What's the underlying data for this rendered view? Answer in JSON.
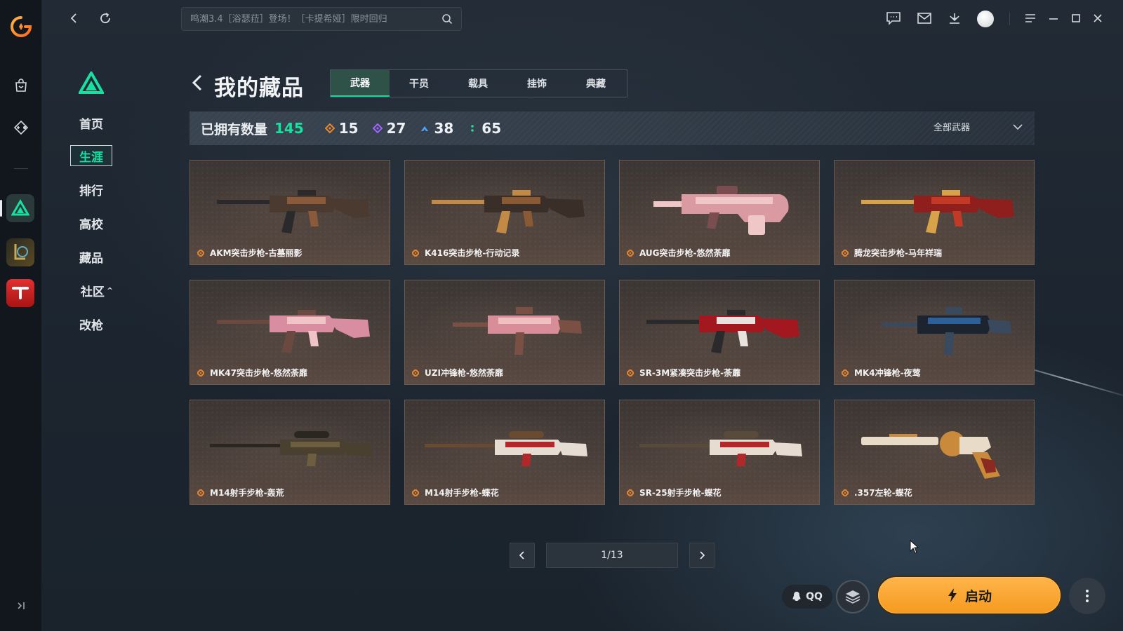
{
  "topbar": {
    "search_placeholder": "鸣潮3.4［浴瑟菈］登场！［卡提希娅］限时回归"
  },
  "sidenav": {
    "items": [
      {
        "label": "首页"
      },
      {
        "label": "生涯",
        "active": true
      },
      {
        "label": "排行"
      },
      {
        "label": "高校"
      },
      {
        "label": "藏品"
      },
      {
        "label": "社区",
        "has_submenu": true
      },
      {
        "label": "改枪"
      }
    ]
  },
  "header": {
    "title": "我的藏品",
    "tabs": [
      {
        "label": "武器",
        "active": true
      },
      {
        "label": "干员"
      },
      {
        "label": "载具"
      },
      {
        "label": "挂饰"
      },
      {
        "label": "典藏"
      }
    ]
  },
  "stats": {
    "owned_label": "已拥有数量",
    "owned_total": "145",
    "rarity_counts": [
      {
        "icon": "orange-diamond-icon",
        "color": "#e8872e",
        "count": "15"
      },
      {
        "icon": "purple-diamond-icon",
        "color": "#a064ff",
        "count": "27"
      },
      {
        "icon": "blue-chevron-icon",
        "color": "#4aa7ff",
        "count": "38"
      },
      {
        "icon": "green-dots-icon",
        "color": "#2fd69c",
        "count": "65"
      }
    ],
    "filter_label": "全部武器"
  },
  "items": [
    {
      "name": "AKM突击步枪-古墓丽影",
      "palette": [
        "#4a3a30",
        "#8a5a3a",
        "#2a2a2c"
      ]
    },
    {
      "name": "K416突击步枪-行动记录",
      "palette": [
        "#3a2e28",
        "#8a5a35",
        "#c28a45"
      ]
    },
    {
      "name": "AUG突击步枪-悠然荼靡",
      "palette": [
        "#d99aa2",
        "#f0c7c7",
        "#7a4d50"
      ]
    },
    {
      "name": "腾龙突击步枪-马年祥瑞",
      "palette": [
        "#8e1f1c",
        "#c23a26",
        "#d8a348"
      ]
    },
    {
      "name": "MK47突击步枪-悠然荼靡",
      "palette": [
        "#d88ea0",
        "#f0c3c7",
        "#6a4a40"
      ]
    },
    {
      "name": "UZI冲锋枪-悠然荼靡",
      "palette": [
        "#d88e98",
        "#f0c0c0",
        "#7a5045"
      ]
    },
    {
      "name": "SR-3M紧凑突击步枪-荼蘼",
      "palette": [
        "#a3181f",
        "#e8e2de",
        "#2a2a2c"
      ]
    },
    {
      "name": "MK4冲锋枪-夜莺",
      "palette": [
        "#1c2430",
        "#2d5f9a",
        "#3a4a5e"
      ]
    },
    {
      "name": "M14射手步枪-轰荒",
      "palette": [
        "#4a4030",
        "#6e5e40",
        "#2a2620"
      ]
    },
    {
      "name": "M14射手步枪-蝶花",
      "palette": [
        "#e6dcd2",
        "#b0282a",
        "#6a4a30"
      ]
    },
    {
      "name": "SR-25射手步枪-蝶花",
      "palette": [
        "#e6dcd2",
        "#b0282a",
        "#5a4a3a"
      ]
    },
    {
      "name": ".357左轮-蝶花",
      "palette": [
        "#e8dcc8",
        "#c98b3b",
        "#8a2a20"
      ]
    }
  ],
  "pagination": {
    "page": "1/13"
  },
  "bottom": {
    "qq_label": "QQ",
    "launch_label": "启动"
  }
}
